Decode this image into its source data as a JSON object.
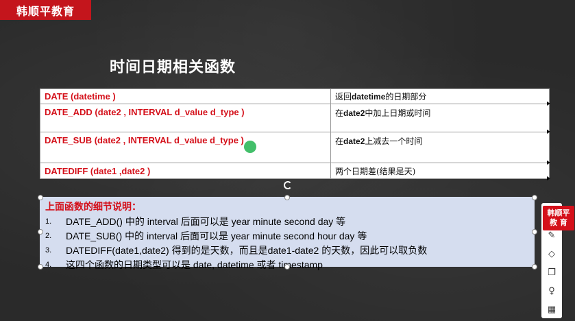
{
  "brand": {
    "logo_text": "韩顺平教育",
    "side_logo_line1": "韩顺平",
    "side_logo_line2": "教 育"
  },
  "slide": {
    "title": "时间日期相关函数",
    "table_rows": [
      {
        "signature": "DATE (datetime )",
        "description_pre": "返回",
        "description_bold": "datetime",
        "description_post": "的日期部分"
      },
      {
        "signature": "DATE_ADD (date2 , INTERVAL d_value d_type )",
        "description_pre": "在",
        "description_bold": "date2",
        "description_post": "中加上日期或时间"
      },
      {
        "signature": "DATE_SUB (date2 , INTERVAL d_value d_type )",
        "description_pre": "在",
        "description_bold": "date2",
        "description_post": "上减去一个时间"
      },
      {
        "signature": "DATEDIFF (date1 ,date2 )",
        "description_pre": "两个日期差(结果是天)",
        "description_bold": "",
        "description_post": ""
      }
    ],
    "notes": {
      "title": "上面函数的细节说明：",
      "items": [
        {
          "num": "1.",
          "text": "DATE_ADD() 中的  interval 后面可以是  year minute second day 等"
        },
        {
          "num": "2.",
          "text": "DATE_SUB() 中的  interval 后面可以是   year minute second hour day 等"
        },
        {
          "num": "3.",
          "text": "DATEDIFF(date1,date2) 得到的是天数，而且是date1-date2 的天数，因此可以取负数"
        },
        {
          "num": "4.",
          "text": "这四个函数的日期类型可以是 date, datetime 或者  timestamp"
        }
      ]
    }
  },
  "toolbar": {
    "icons": [
      "pen-icon",
      "eraser-icon",
      "copy-icon",
      "bulb-icon",
      "grid-icon"
    ],
    "glyphs": [
      "✎",
      "◇",
      "❐",
      "♀",
      "▦"
    ]
  }
}
